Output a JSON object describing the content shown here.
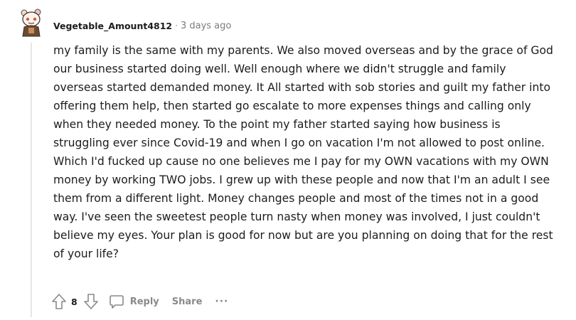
{
  "comment": {
    "author": "Vegetable_Amount4812",
    "separator": "·",
    "timestamp": "3 days ago",
    "body": "my family is the same with my parents. We also moved overseas and by the grace of God our business started doing well. Well enough where we didn't struggle and family overseas started demanded money. It All started with sob stories and guilt my father into offering them help, then started go escalate to more expenses things and calling only when they needed money. To the point my father started saying how business is struggling ever since Covid-19 and when I go on vacation I'm not allowed to post online. Which I'd fucked up cause no one believes me I pay for my OWN vacations with my OWN money by working TWO jobs. I grew up with these people and now that I'm an adult I see them from a different light. Money changes people and most of the times not in a good way. I've seen the sweetest people turn nasty when money was involved, I just couldn't believe my eyes. Your plan is good for now but are you planning on doing that for the rest of your life?",
    "vote_count": "8",
    "reply_label": "Reply",
    "share_label": "Share",
    "more_label": "···"
  },
  "icons": {
    "avatar": "snoo-avatar",
    "upvote": "upvote-arrow-icon",
    "downvote": "downvote-arrow-icon",
    "reply": "comment-bubble-icon",
    "more": "ellipsis-icon"
  },
  "colors": {
    "text": "#1c1c1c",
    "meta": "#878a8c",
    "thread_line": "#e6e6e6"
  }
}
